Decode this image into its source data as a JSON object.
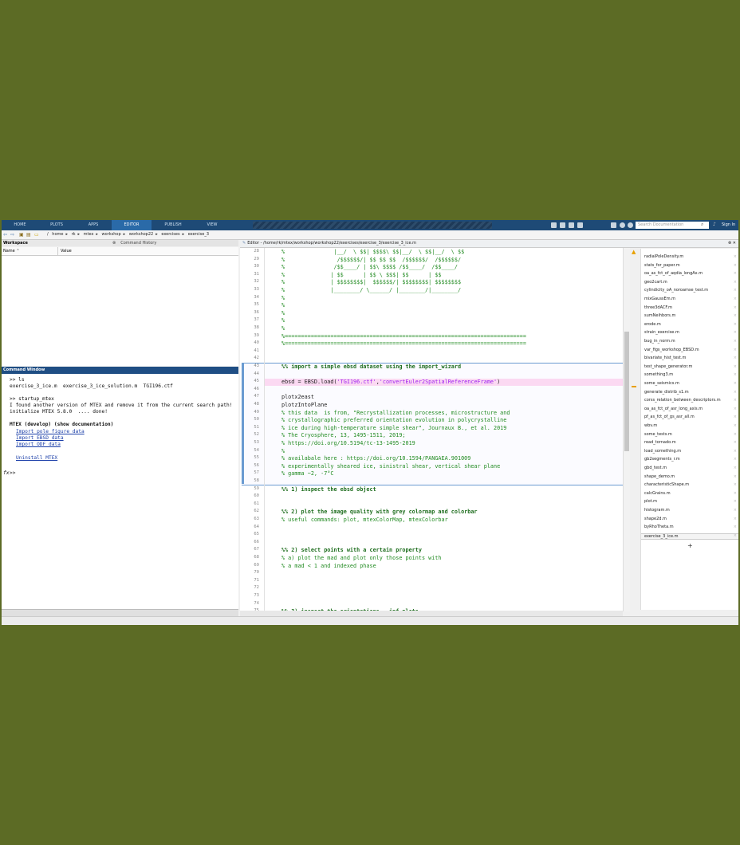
{
  "ribbon": {
    "tabs": [
      "HOME",
      "PLOTS",
      "APPS",
      "EDITOR",
      "PUBLISH",
      "VIEW"
    ],
    "search_placeholder": "Search Documentation",
    "sign_in": "Sign In"
  },
  "path": [
    "/",
    "home",
    "rk",
    "mtex",
    "workshop",
    "workshop22",
    "exercises",
    "exercise_3"
  ],
  "workspace": {
    "title": "Workspace",
    "history_title": "Command History",
    "col_name": "Name ⌃",
    "col_value": "Value"
  },
  "command_window": {
    "title": "Command Window",
    "lines": [
      ">> ls",
      "exercise_3_ice.m  exercise_3_ice_solution.m  TGI196.ctf",
      "",
      ">> startup_mtex",
      "I found another version of MTEX and remove it from the current search path!",
      "initialize MTEX 5.8.0  .... done!",
      "",
      "MTEX (develop) (show documentation)"
    ],
    "links": [
      "Import pole figure data",
      "Import EBSD data",
      "Import ODF data",
      "Uninstall MTEX"
    ],
    "prompt": ">>",
    "fx": "fx"
  },
  "editor": {
    "title": "Editor - /home/rk/mtex/workshop/workshop22/exercises/exercise_3/exercise_3_ice.m",
    "lines": [
      {
        "n": "28",
        "t": "%               |__/  \\ $$| $$$$\\ $$|__/  \\ $$|__/  \\ $$",
        "k": "cmt"
      },
      {
        "n": "29",
        "t": "%                /$$$$$$/| $$ $$ $$  /$$$$$$/  /$$$$$$/",
        "k": "cmt"
      },
      {
        "n": "30",
        "t": "%               /$$____/ | $$\\ $$$$ /$$____/  /$$____/",
        "k": "cmt"
      },
      {
        "n": "31",
        "t": "%              | $$      | $$ \\ $$$| $$      | $$",
        "k": "cmt"
      },
      {
        "n": "32",
        "t": "%              | $$$$$$$$|  $$$$$$/| $$$$$$$$| $$$$$$$$",
        "k": "cmt"
      },
      {
        "n": "33",
        "t": "%              |________/ \\______/ |________/|________/",
        "k": "cmt"
      },
      {
        "n": "34",
        "t": "%",
        "k": "cmt"
      },
      {
        "n": "35",
        "t": "%",
        "k": "cmt"
      },
      {
        "n": "36",
        "t": "%",
        "k": "cmt"
      },
      {
        "n": "37",
        "t": "%",
        "k": "cmt"
      },
      {
        "n": "38",
        "t": "%",
        "k": "cmt"
      },
      {
        "n": "39",
        "t": "%==========================================================================",
        "k": "cmt"
      },
      {
        "n": "40",
        "t": "%==========================================================================",
        "k": "cmt"
      },
      {
        "n": "41",
        "t": "",
        "k": ""
      },
      {
        "n": "42",
        "t": "",
        "k": ""
      },
      {
        "n": "43",
        "t": "%% import a simple ebsd dataset using the import_wizard",
        "k": "sec"
      },
      {
        "n": "44",
        "t": "",
        "k": ""
      },
      {
        "n": "45",
        "t": "ebsd = EBSD.load('TGI196.ctf','convertEuler2SpatialReferenceFrame')",
        "k": "code"
      },
      {
        "n": "46",
        "t": "",
        "k": ""
      },
      {
        "n": "47",
        "t": "plotx2east",
        "k": "code"
      },
      {
        "n": "48",
        "t": "plotzIntoPlane",
        "k": "code"
      },
      {
        "n": "49",
        "t": "% this data  is from, \"Recrystallization processes, microstructure and",
        "k": "cmt"
      },
      {
        "n": "50",
        "t": "% crystallographic preferred orientation evolution in polycrystalline",
        "k": "cmt"
      },
      {
        "n": "51",
        "t": "% ice during high-temperature simple shear\", Journaux B., et al. 2019",
        "k": "cmt"
      },
      {
        "n": "52",
        "t": "% The Cryosphere, 13, 1495-1511, 2019;",
        "k": "cmt"
      },
      {
        "n": "53",
        "t": "% https://doi.org/10.5194/tc-13-1495-2019",
        "k": "cmt"
      },
      {
        "n": "54",
        "t": "%",
        "k": "cmt"
      },
      {
        "n": "55",
        "t": "% availabale here : https://doi.org/10.1594/PANGAEA.901009",
        "k": "cmt"
      },
      {
        "n": "56",
        "t": "% experimentally sheared ice, sinistral shear, vertical shear plane",
        "k": "cmt"
      },
      {
        "n": "57",
        "t": "% gamma ~2, -7°C",
        "k": "cmt"
      },
      {
        "n": "58",
        "t": "",
        "k": ""
      },
      {
        "n": "59",
        "t": "%% 1) inspect the ebsd object",
        "k": "sec"
      },
      {
        "n": "60",
        "t": "",
        "k": ""
      },
      {
        "n": "61",
        "t": "",
        "k": ""
      },
      {
        "n": "62",
        "t": "%% 2) plot the image quality with grey colormap and colorbar",
        "k": "sec"
      },
      {
        "n": "63",
        "t": "% useful commands: plot, mtexColorMap, mtexColorbar",
        "k": "cmt"
      },
      {
        "n": "64",
        "t": "",
        "k": ""
      },
      {
        "n": "65",
        "t": "",
        "k": ""
      },
      {
        "n": "66",
        "t": "",
        "k": ""
      },
      {
        "n": "67",
        "t": "%% 2) select points with a certain property",
        "k": "sec"
      },
      {
        "n": "68",
        "t": "% a) plot the mad and plot only those points with",
        "k": "cmt"
      },
      {
        "n": "69",
        "t": "% a mad < 1 and indexed phase",
        "k": "cmt"
      },
      {
        "n": "70",
        "t": "",
        "k": ""
      },
      {
        "n": "71",
        "t": "",
        "k": ""
      },
      {
        "n": "72",
        "t": "",
        "k": ""
      },
      {
        "n": "73",
        "t": "",
        "k": ""
      },
      {
        "n": "74",
        "t": "",
        "k": ""
      },
      {
        "n": "75",
        "t": "%% 3) inspect the orientations - ipf plots",
        "k": "sec"
      }
    ]
  },
  "files": [
    "radialPoleDensity.m",
    "stats_for_paper.m",
    "oa_as_fct_of_aqdia_longAx.m",
    "geo2cart.m",
    "cylindicity_oA_noroamse_test.m",
    "mixGaussEm.m",
    "three3dACF.m",
    "sumNeihbors.m",
    "erode.m",
    "strain_exercise.m",
    "bug_in_norm.m",
    "var_figs_workshop_EBSD.m",
    "bivariate_hist_test.m",
    "test_shape_generator.m",
    "something3.m",
    "some_seismics.m",
    "generate_distrib_s1.m",
    "corss_relation_between_descriptors.m",
    "oa_as_fct_of_asr_long_axis.m",
    "pf_as_fct_of_gs_asr_all.m",
    "wbv.m",
    "some_tests.m",
    "read_tornado.m",
    "load_something.m",
    "gb2segments_r.m",
    "gbd_test.m",
    "shape_demo.m",
    "characteristicShape.m",
    "calcGrains.m",
    "plot.m",
    "histogram.m",
    "shape2d.m",
    "byRhoTheta.m",
    "exercise_3_ice.m"
  ],
  "add_tab": "+"
}
